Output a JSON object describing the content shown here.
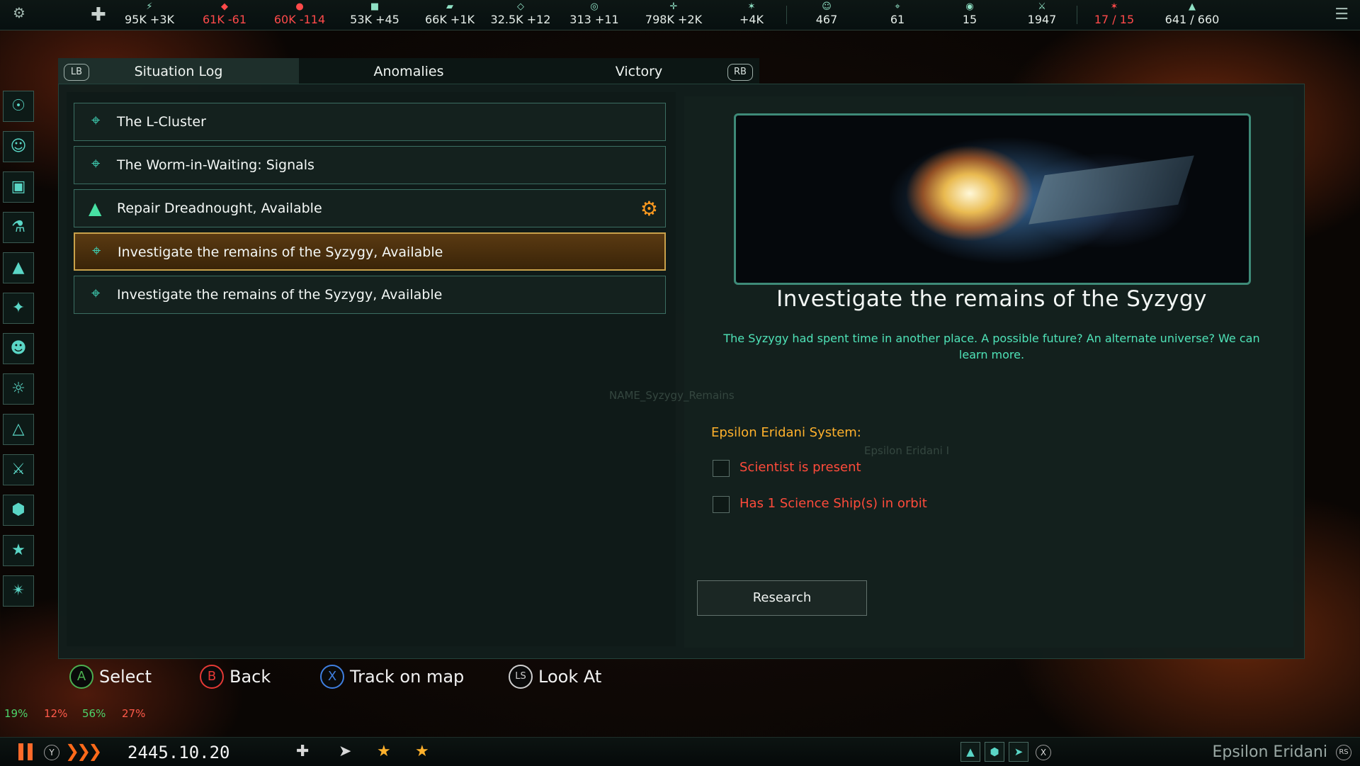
{
  "topbar": {
    "resources": [
      {
        "icon": "energy",
        "value": "95K +3K",
        "neg": false
      },
      {
        "icon": "minerals",
        "value": "61K -61",
        "neg": true
      },
      {
        "icon": "food",
        "value": "60K -114",
        "neg": true
      },
      {
        "icon": "alloys",
        "value": "53K +45",
        "neg": false
      },
      {
        "icon": "consumer-goods",
        "value": "66K +1K",
        "neg": false
      },
      {
        "icon": "influence",
        "value": "32.5K +12",
        "neg": false
      },
      {
        "icon": "unity",
        "value": "313 +11",
        "neg": false
      },
      {
        "icon": "research",
        "value": "798K +2K",
        "neg": false
      },
      {
        "icon": "strategic",
        "value": "+4K",
        "neg": false
      },
      {
        "icon": "pops",
        "value": "467",
        "neg": false
      },
      {
        "icon": "planets",
        "value": "61",
        "neg": false
      },
      {
        "icon": "systems",
        "value": "15",
        "neg": false
      },
      {
        "icon": "fleet-power",
        "value": "1947",
        "neg": false
      },
      {
        "icon": "starbases",
        "value": "17 / 15",
        "neg": true
      },
      {
        "icon": "naval-capacity",
        "value": "641 / 660",
        "neg": false
      }
    ]
  },
  "tabs": {
    "lb": "LB",
    "rb": "RB",
    "situation": "Situation Log",
    "anomalies": "Anomalies",
    "victory": "Victory"
  },
  "entries": [
    {
      "label": "The L-Cluster"
    },
    {
      "label": "The Worm-in-Waiting: Signals"
    },
    {
      "label": "Repair Dreadnought, Available"
    },
    {
      "label": "Investigate the remains of the Syzygy, Available"
    },
    {
      "label": "Investigate the remains of the Syzygy, Available"
    }
  ],
  "detail": {
    "title": "Investigate the remains of the Syzygy",
    "description": "The Syzygy had spent time in another place. A possible future? An alternate universe? We can learn more.",
    "ghost_name": "NAME_Syzygy_Remains",
    "ghost_system": "Epsilon Eridani I",
    "system_label": "Epsilon Eridani System:",
    "conditions": [
      "Scientist is present",
      "Has 1 Science Ship(s) in orbit"
    ],
    "research_button": "Research"
  },
  "hints": {
    "a": "A",
    "select": "Select",
    "b": "B",
    "back": "Back",
    "x": "X",
    "track": "Track on map",
    "ls": "LS",
    "look": "Look At"
  },
  "percents": [
    "19%",
    "12%",
    "56%",
    "27%"
  ],
  "bottombar": {
    "y": "Y",
    "date": "2445.10.20",
    "location": "Epsilon Eridani",
    "rs": "RS",
    "x": "X"
  },
  "colors": {
    "accent": "#3fd0b4",
    "warning": "#ff4b3b",
    "selected": "#c9a14a",
    "title_orange": "#ffb12c"
  }
}
